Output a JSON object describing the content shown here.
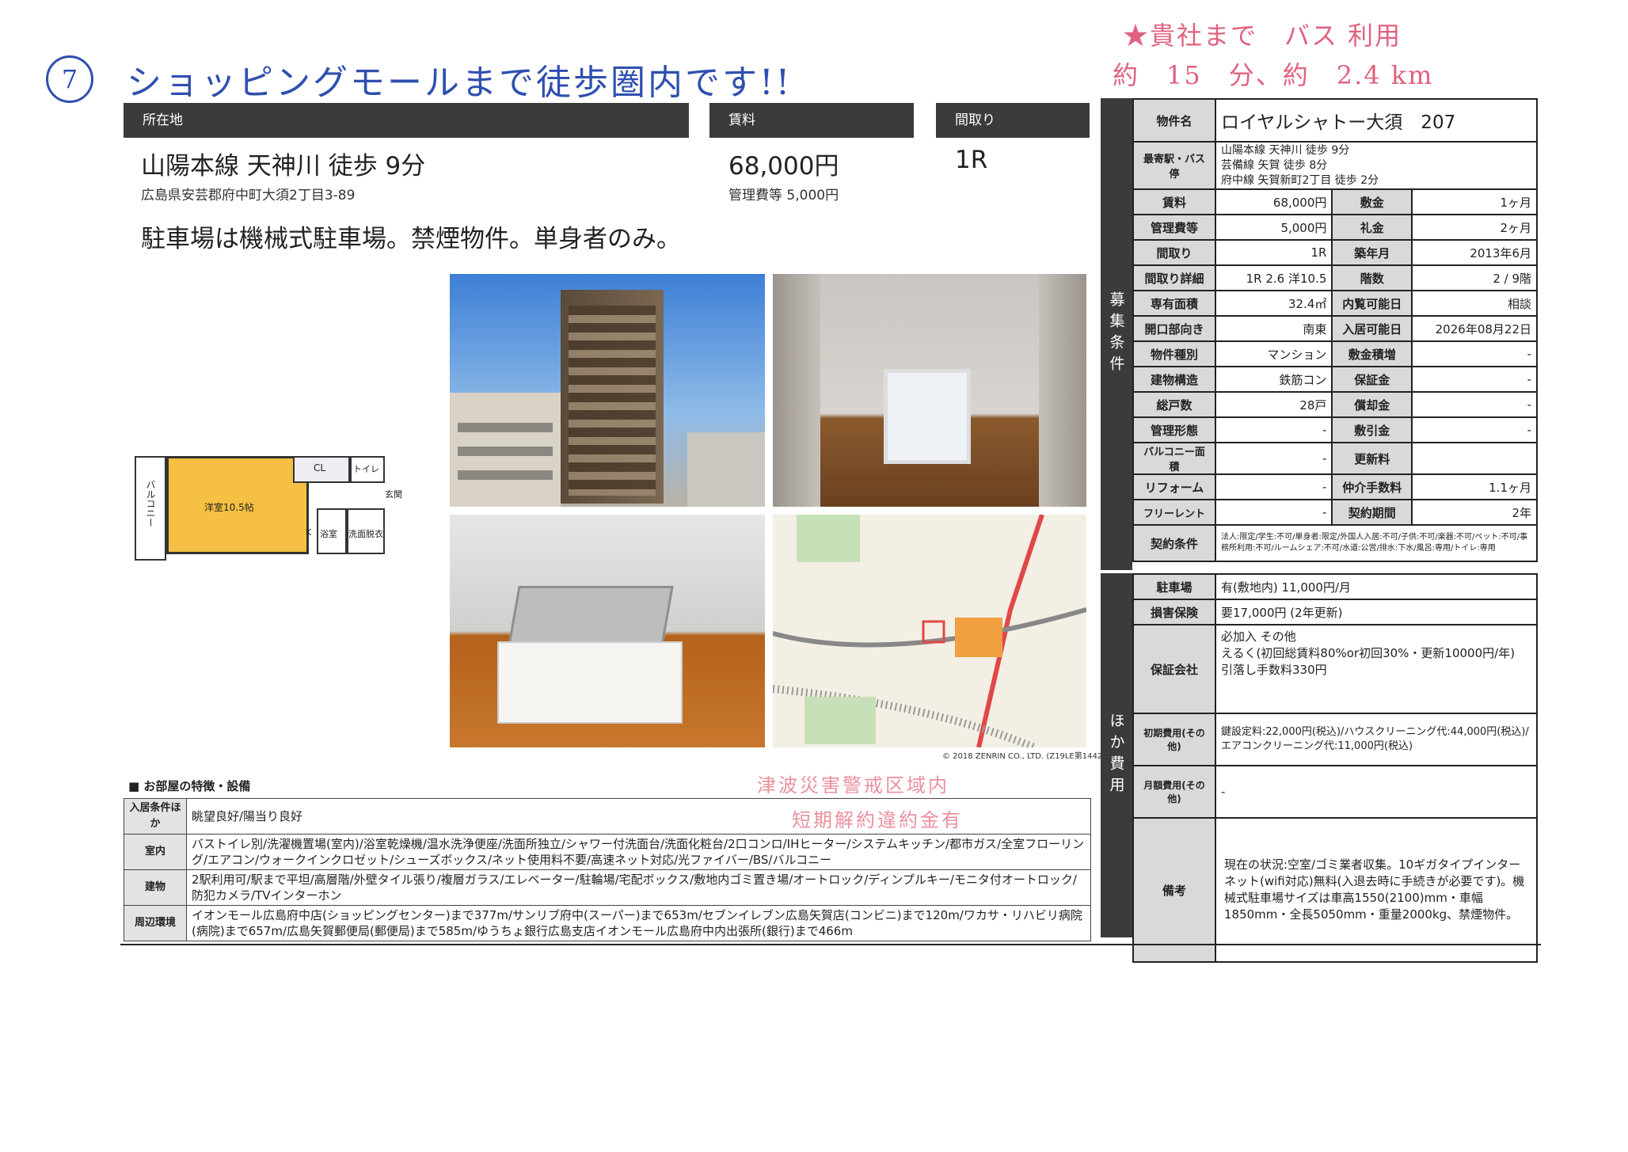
{
  "handwriting": {
    "circle_number": "7",
    "note": "ショッピングモールまで徒歩圏内です!!",
    "red_line1": "★貴社まで　バス 利用",
    "red_line2": "約　15　分、約　2.4 km"
  },
  "header": {
    "location_label": "所在地",
    "rent_label": "賃料",
    "layout_label": "間取り"
  },
  "summary": {
    "station": "山陽本線 天神川 徒歩 9分",
    "address": "広島県安芸郡府中町大須2丁目3-89",
    "rent": "68,000円",
    "fee": "管理費等 5,000円",
    "layout": "1R",
    "headline": "駐車場は機械式駐車場。禁煙物件。単身者のみ。"
  },
  "floorplan": {
    "balcony": "バルコニー",
    "room": "洋室10.5帖",
    "cl": "CL",
    "toilet": "トイレ",
    "entrance": "玄関",
    "bath": "浴室",
    "washroom": "洗面脱衣",
    "kitchen": "K"
  },
  "map": {
    "credit": "© 2018 ZENRIN CO., LTD. (Z19LE第1442号)"
  },
  "property": {
    "name_label": "物件名",
    "name": "ロイヤルシャトー大須　207",
    "station_label": "最寄駅・バス停",
    "stations": [
      "山陽本線 天神川 徒歩 9分",
      "芸備線 矢賀 徒歩 8分",
      "府中線 矢賀新町2丁目 徒歩 2分"
    ],
    "side_recruit": "募集条件",
    "rows": [
      [
        "賃料",
        "68,000円",
        "敷金",
        "1ヶ月"
      ],
      [
        "管理費等",
        "5,000円",
        "礼金",
        "2ヶ月"
      ],
      [
        "間取り",
        "1R",
        "築年月",
        "2013年6月"
      ],
      [
        "間取り詳細",
        "1R 2.6 洋10.5",
        "階数",
        "2 / 9階"
      ],
      [
        "専有面積",
        "32.4㎡",
        "内覧可能日",
        "相談"
      ],
      [
        "開口部向き",
        "南東",
        "入居可能日",
        "2026年08月22日"
      ],
      [
        "物件種別",
        "マンション",
        "敷金積増",
        "-"
      ],
      [
        "建物構造",
        "鉄筋コン",
        "保証金",
        "-"
      ],
      [
        "総戸数",
        "28戸",
        "償却金",
        "-"
      ],
      [
        "管理形態",
        "-",
        "敷引金",
        "-"
      ],
      [
        "バルコニー面積",
        "-",
        "更新料",
        ""
      ],
      [
        "リフォーム",
        "-",
        "仲介手数料",
        "1.1ヶ月"
      ],
      [
        "フリーレント",
        "-",
        "契約期間",
        "2年"
      ]
    ],
    "contract_label": "契約条件",
    "contract": "法人:限定/学生:不可/単身者:限定/外国人入居:不可/子供:不可/楽器:不可/ペット:不可/事務所利用:不可/ルームシェア:不可/水道:公営/排水:下水/風呂:専用/トイレ:専用"
  },
  "costs": {
    "side_other": "ほか費用",
    "parking_label": "駐車場",
    "parking": "有(敷地内) 11,000円/月",
    "insurance_label": "損害保険",
    "insurance": "要17,000円 (2年更新)",
    "guarantee_label": "保証会社",
    "guarantee": [
      "必加入 その他",
      "えるく(初回総賃料80%or初回30%・更新10000円/年)",
      "引落し手数料330円"
    ],
    "initial_label": "初期費用(その他)",
    "initial": "鍵設定料:22,000円(税込)/ハウスクリーニング代:44,000円(税込)/エアコンクリーニング代:11,000円(税込)",
    "monthly_label": "月額費用(その他)",
    "monthly": "-",
    "remarks_label": "備考",
    "remarks": "現在の状況:空室/ゴミ業者収集。10ギガタイプインターネット(wifi対応)無料(入退去時に手続きが必要です)。機械式駐車場サイズは車高1550(2100)mm・車幅1850mm・全長5050mm・重量2000kg、禁煙物件。"
  },
  "features": {
    "title": "■ お部屋の特徴・設備",
    "stamp1": "津波災害警戒区域内",
    "stamp2": "短期解約違約金有",
    "rows": [
      {
        "label": "入居条件ほか",
        "text": "眺望良好/陽当り良好"
      },
      {
        "label": "室内",
        "text": "バストイレ別/洗濯機置場(室内)/浴室乾燥機/温水洗浄便座/洗面所独立/シャワー付洗面台/洗面化粧台/2口コンロ/IHヒーター/システムキッチン/都市ガス/全室フローリング/エアコン/ウォークインクロゼット/シューズボックス/ネット使用料不要/高速ネット対応/光ファイバー/BS/バルコニー"
      },
      {
        "label": "建物",
        "text": "2駅利用可/駅まで平坦/高層階/外壁タイル張り/複層ガラス/エレベーター/駐輪場/宅配ボックス/敷地内ゴミ置き場/オートロック/ディンプルキー/モニタ付オートロック/防犯カメラ/TVインターホン"
      },
      {
        "label": "周辺環境",
        "text": "イオンモール広島府中店(ショッピングセンター)まで377m/サンリブ府中(スーパー)まで653m/セブンイレブン広島矢賀店(コンビニ)まで120m/ワカサ・リハビリ病院(病院)まで657m/広島矢賀郵便局(郵便局)まで585m/ゆうちょ銀行広島支店イオンモール広島府中内出張所(銀行)まで466m"
      }
    ]
  }
}
